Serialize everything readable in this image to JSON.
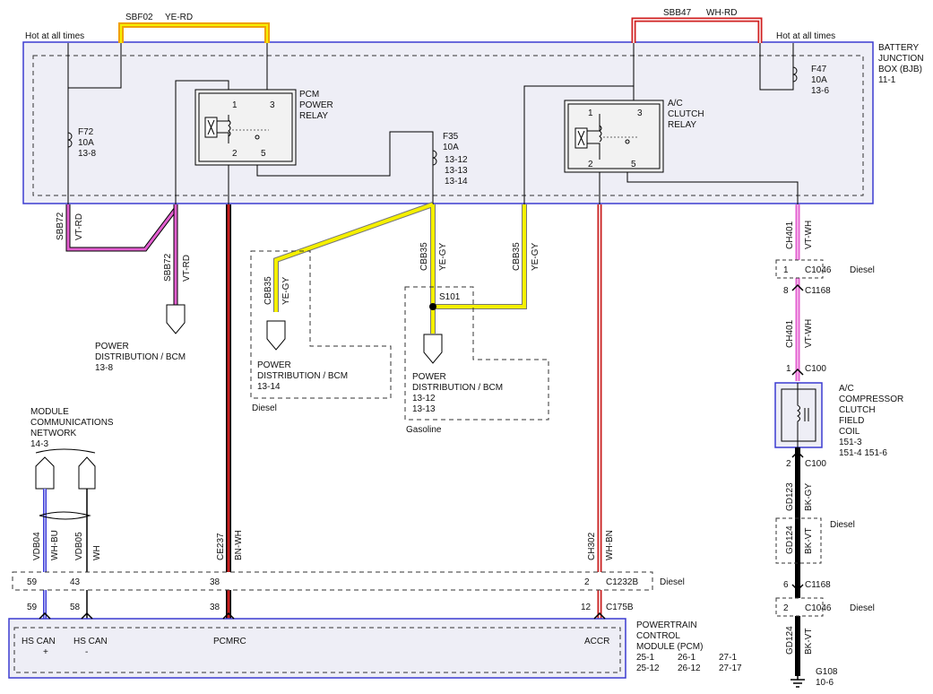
{
  "colors": {
    "bjb_fill": "#eeeef6",
    "bjb_stroke": "#3b3bd1",
    "yellow": "#f5f000",
    "orange": "#f0a000",
    "pink": "#e35fd0",
    "red": "#c81e1e",
    "blue": "#3a3ad8",
    "black": "#000000"
  },
  "labels": {
    "hot_left": "Hot at all times",
    "hot_right": "Hot at all times",
    "sbf02": "SBF02",
    "sbf02_color": "YE-RD",
    "sbb47": "SBB47",
    "sbb47_color": "WH-RD",
    "bjb_l1": "BATTERY",
    "bjb_l2": "JUNCTION",
    "bjb_l3": "BOX (BJB)",
    "bjb_l4": "11-1",
    "f47": "F47",
    "f47_a": "10A",
    "f47_ref": "13-6",
    "f72": "F72",
    "f72_a": "10A",
    "f72_ref": "13-8",
    "f35": "F35",
    "f35_a": "10A",
    "f35_r1": "13-12",
    "f35_r2": "13-13",
    "f35_r3": "13-14",
    "pcm_l1": "PCM",
    "pcm_l2": "POWER",
    "pcm_l3": "RELAY",
    "ac_l1": "A/C",
    "ac_l2": "CLUTCH",
    "ac_l3": "RELAY",
    "pin1": "1",
    "pin2": "2",
    "pin3": "3",
    "pin5": "5",
    "sbb72a": "SBB72",
    "vtrd_a": "VT-RD",
    "sbb72b": "SBB72",
    "vtrd_b": "VT-RD",
    "pd1_l1": "POWER",
    "pd1_l2": "DISTRIBUTION / BCM",
    "pd1_l3": "13-8",
    "cbb35_a": "CBB35",
    "yegy_a": "YE-GY",
    "cbb35_b": "CBB35",
    "yegy_b": "YE-GY",
    "cbb35_c": "CBB35",
    "yegy_c": "YE-GY",
    "s101": "S101",
    "pd2_l1": "POWER",
    "pd2_l2": "DISTRIBUTION / BCM",
    "pd2_l3": "13-14",
    "diesel_pd2": "Diesel",
    "pd3_l1": "POWER",
    "pd3_l2": "DISTRIBUTION / BCM",
    "pd3_l3": "13-12",
    "pd3_l4": "13-13",
    "gasoline": "Gasoline",
    "ch401_a": "CH401",
    "vtwh_a": "VT-WH",
    "c1046_1": "C1046",
    "c1046_1_pin": "1",
    "diesel_c1046": "Diesel",
    "c1168_1": "C1168",
    "c1168_1_pin": "8",
    "ch401_b": "CH401",
    "vtwh_b": "VT-WH",
    "c100_1": "C100",
    "c100_1_pin": "1",
    "acc_l1": "A/C",
    "acc_l2": "COMPRESSOR",
    "acc_l3": "CLUTCH",
    "acc_l4": "FIELD",
    "acc_l5": "COIL",
    "acc_l6": "151-3",
    "acc_l7": "151-4   151-6",
    "c100_2": "C100",
    "c100_2_pin": "2",
    "gd123": "GD123",
    "bkgy": "BK-GY",
    "gd124_a": "GD124",
    "bkvt_a": "BK-VT",
    "diesel_gd": "Diesel",
    "c1168_2": "C1168",
    "c1168_2_pin": "6",
    "c1046_2": "C1046",
    "c1046_2_pin": "2",
    "diesel_c1046b": "Diesel",
    "gd124_b": "GD124",
    "bkvt_b": "BK-VT",
    "g108": "G108",
    "g108_ref": "10-6",
    "mcn_l1": "MODULE",
    "mcn_l2": "COMMUNICATIONS",
    "mcn_l3": "NETWORK",
    "mcn_l4": "14-3",
    "vdb04": "VDB04",
    "whbu": "WH-BU",
    "vdb05": "VDB05",
    "wh": "WH",
    "ce237": "CE237",
    "bnwh": "BN-WH",
    "ch302": "CH302",
    "whbn": "WH-BN",
    "c1232b_59": "59",
    "c1232b_43": "43",
    "c1232b_38": "38",
    "c1232b_2": "2",
    "c1232b": "C1232B",
    "diesel_c1232b": "Diesel",
    "c175b_59": "59",
    "c175b_58": "58",
    "c175b_38": "38",
    "c175b_12": "12",
    "c175b": "C175B",
    "pcm_hscan1": "HS CAN",
    "pcm_plus": "+",
    "pcm_hscan2": "HS CAN",
    "pcm_minus": "-",
    "pcmrc": "PCMRC",
    "accr": "ACCR",
    "pcm_m1": "POWERTRAIN",
    "pcm_m2": "CONTROL",
    "pcm_m3": "MODULE (PCM)",
    "pcm_r1a": "25-1",
    "pcm_r1b": "26-1",
    "pcm_r1c": "27-1",
    "pcm_r2a": "25-12",
    "pcm_r2b": "26-12",
    "pcm_r2c": "27-17"
  }
}
